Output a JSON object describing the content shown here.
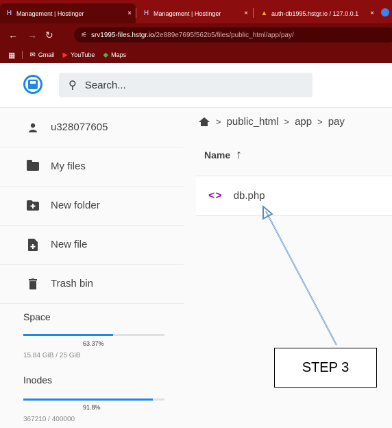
{
  "browser": {
    "tabs": [
      {
        "title": "Management | Hostinger",
        "close": "×"
      },
      {
        "title": "Management | Hostinger",
        "close": "×"
      },
      {
        "title": "auth-db1995.hstgr.io / 127.0.0.1",
        "close": "×"
      }
    ],
    "url_host": "srv1995-files.hstgr.io",
    "url_path": "/2e889e7695f562b5/files/public_html/app/pay/",
    "bookmarks": [
      {
        "label": "Gmail",
        "icon": "gmail-icon"
      },
      {
        "label": "YouTube",
        "icon": "youtube-icon"
      },
      {
        "label": "Maps",
        "icon": "maps-icon"
      }
    ]
  },
  "header": {
    "search_placeholder": "Search..."
  },
  "sidebar": {
    "user": "u328077605",
    "items": [
      {
        "label": "My files",
        "icon": "folder-icon"
      },
      {
        "label": "New folder",
        "icon": "new-folder-icon"
      },
      {
        "label": "New file",
        "icon": "new-file-icon"
      },
      {
        "label": "Trash bin",
        "icon": "trash-icon"
      }
    ],
    "space": {
      "label": "Space",
      "percent_text": "63.37%",
      "percent": 63.37,
      "detail": "15.84 GiB / 25 GiB"
    },
    "inodes": {
      "label": "Inodes",
      "percent_text": "91.8%",
      "percent": 91.8,
      "detail": "367210 / 400000"
    }
  },
  "main": {
    "breadcrumb": [
      "public_html",
      "app",
      "pay"
    ],
    "column_name": "Name",
    "files": [
      {
        "name": "db.php",
        "icon": "code-file-icon"
      }
    ]
  },
  "annotation": {
    "label": "STEP 3"
  },
  "colors": {
    "accent": "#1e88e5",
    "browser_frame": "#8b0d0d",
    "code_icon": "#8e24aa"
  }
}
